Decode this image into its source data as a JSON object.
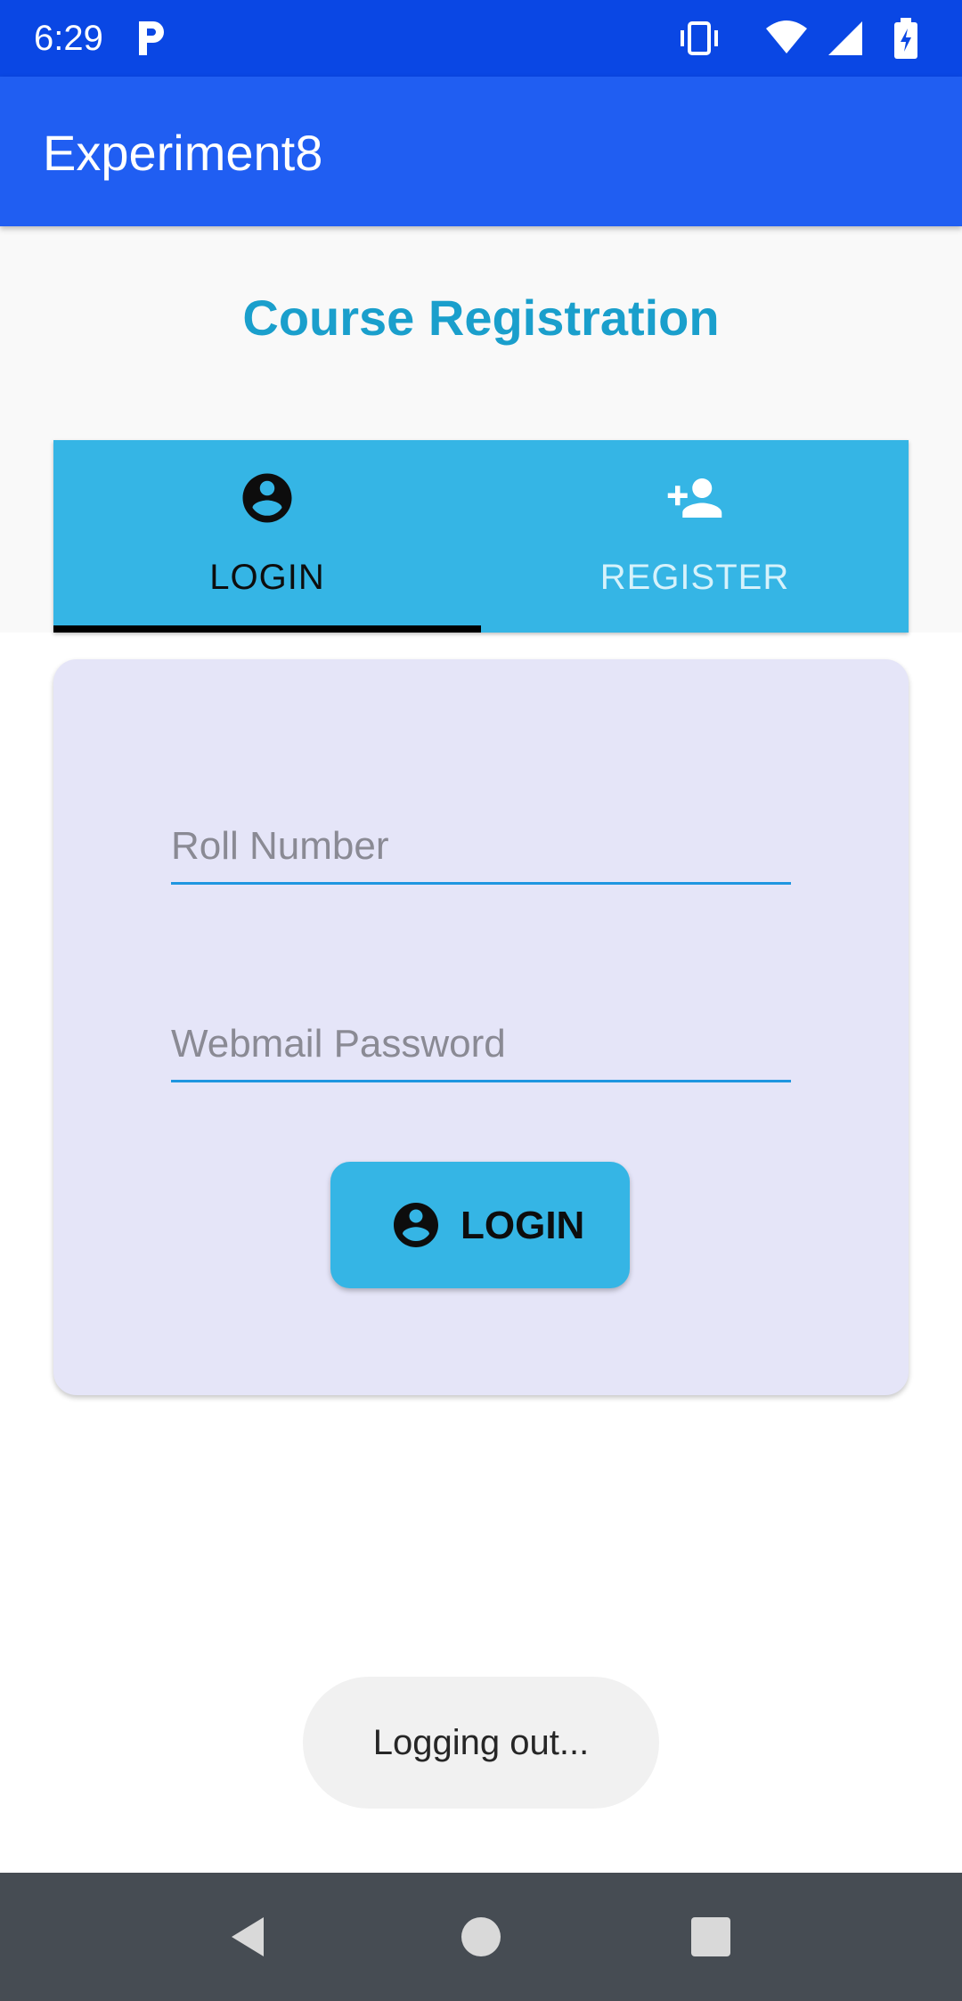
{
  "status_bar": {
    "time": "6:29",
    "icons": [
      "parking-icon",
      "vibrate-icon",
      "wifi-icon",
      "signal-icon",
      "battery-charging-icon"
    ]
  },
  "app_bar": {
    "title": "Experiment8"
  },
  "page": {
    "heading": "Course Registration"
  },
  "tabs": [
    {
      "label": "LOGIN",
      "icon": "account-circle-icon",
      "selected": true
    },
    {
      "label": "REGISTER",
      "icon": "person-add-icon",
      "selected": false
    }
  ],
  "login_form": {
    "roll_number": {
      "value": "",
      "placeholder": "Roll Number"
    },
    "password": {
      "value": "",
      "placeholder": "Webmail Password"
    },
    "submit_label": "LOGIN",
    "submit_icon": "account-circle-icon"
  },
  "toast": {
    "message": "Logging out..."
  },
  "nav_bar": {
    "buttons": [
      "back-icon",
      "home-icon",
      "recents-icon"
    ]
  },
  "colors": {
    "status_bar": "#0a47e4",
    "app_bar": "#205ef2",
    "heading": "#1a9fcc",
    "tab_bar": "#35b5e5",
    "card": "#e5e5f8",
    "field_underline": "#1f96e0",
    "button": "#35b5e5",
    "nav_bar": "#464c53"
  }
}
